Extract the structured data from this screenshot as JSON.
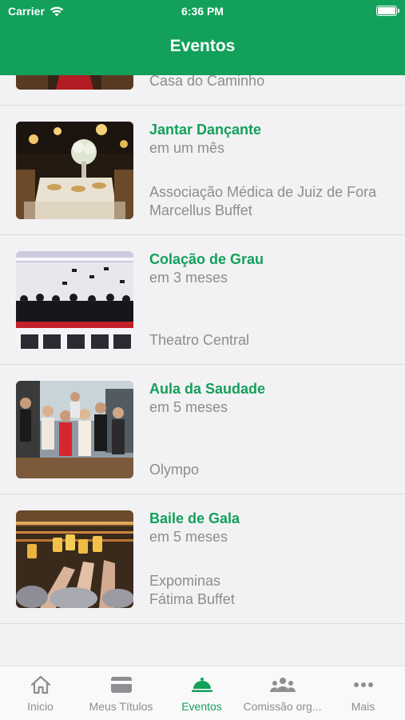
{
  "status_bar": {
    "carrier": "Carrier",
    "time": "6:36 PM"
  },
  "header": {
    "title": "Eventos"
  },
  "events": [
    {
      "title": "",
      "when": "",
      "venue": [
        "Casa do Caminho"
      ],
      "image": "red-carpet-hall"
    },
    {
      "title": "Jantar Dançante",
      "when": "em um mês",
      "venue": [
        "Associação Médica de Juiz de Fora",
        "Marcellus Buffet"
      ],
      "image": "banquet-table"
    },
    {
      "title": "Colação de Grau",
      "when": "em 3 meses",
      "venue": [
        "Theatro Central"
      ],
      "image": "graduation-caps"
    },
    {
      "title": "Aula da Saudade",
      "when": "em 5 meses",
      "venue": [
        "Olympo"
      ],
      "image": "group-photo"
    },
    {
      "title": "Baile de Gala",
      "when": "em 5 meses",
      "venue": [
        "Expominas",
        "Fátima Buffet"
      ],
      "image": "toast-glasses"
    }
  ],
  "tabbar": {
    "active": "Eventos",
    "tabs": [
      {
        "label": "Inicio",
        "icon": "home-icon"
      },
      {
        "label": "Meus Títulos",
        "icon": "card-icon"
      },
      {
        "label": "Eventos",
        "icon": "cloche-icon"
      },
      {
        "label": "Comissão org...",
        "icon": "people-icon"
      },
      {
        "label": "Mais",
        "icon": "dots-icon"
      }
    ]
  },
  "colors": {
    "brand": "#12a05a",
    "title_text": "#13a05a",
    "muted_text": "#8d8d8d",
    "inactive_tab": "#8e8e93"
  }
}
